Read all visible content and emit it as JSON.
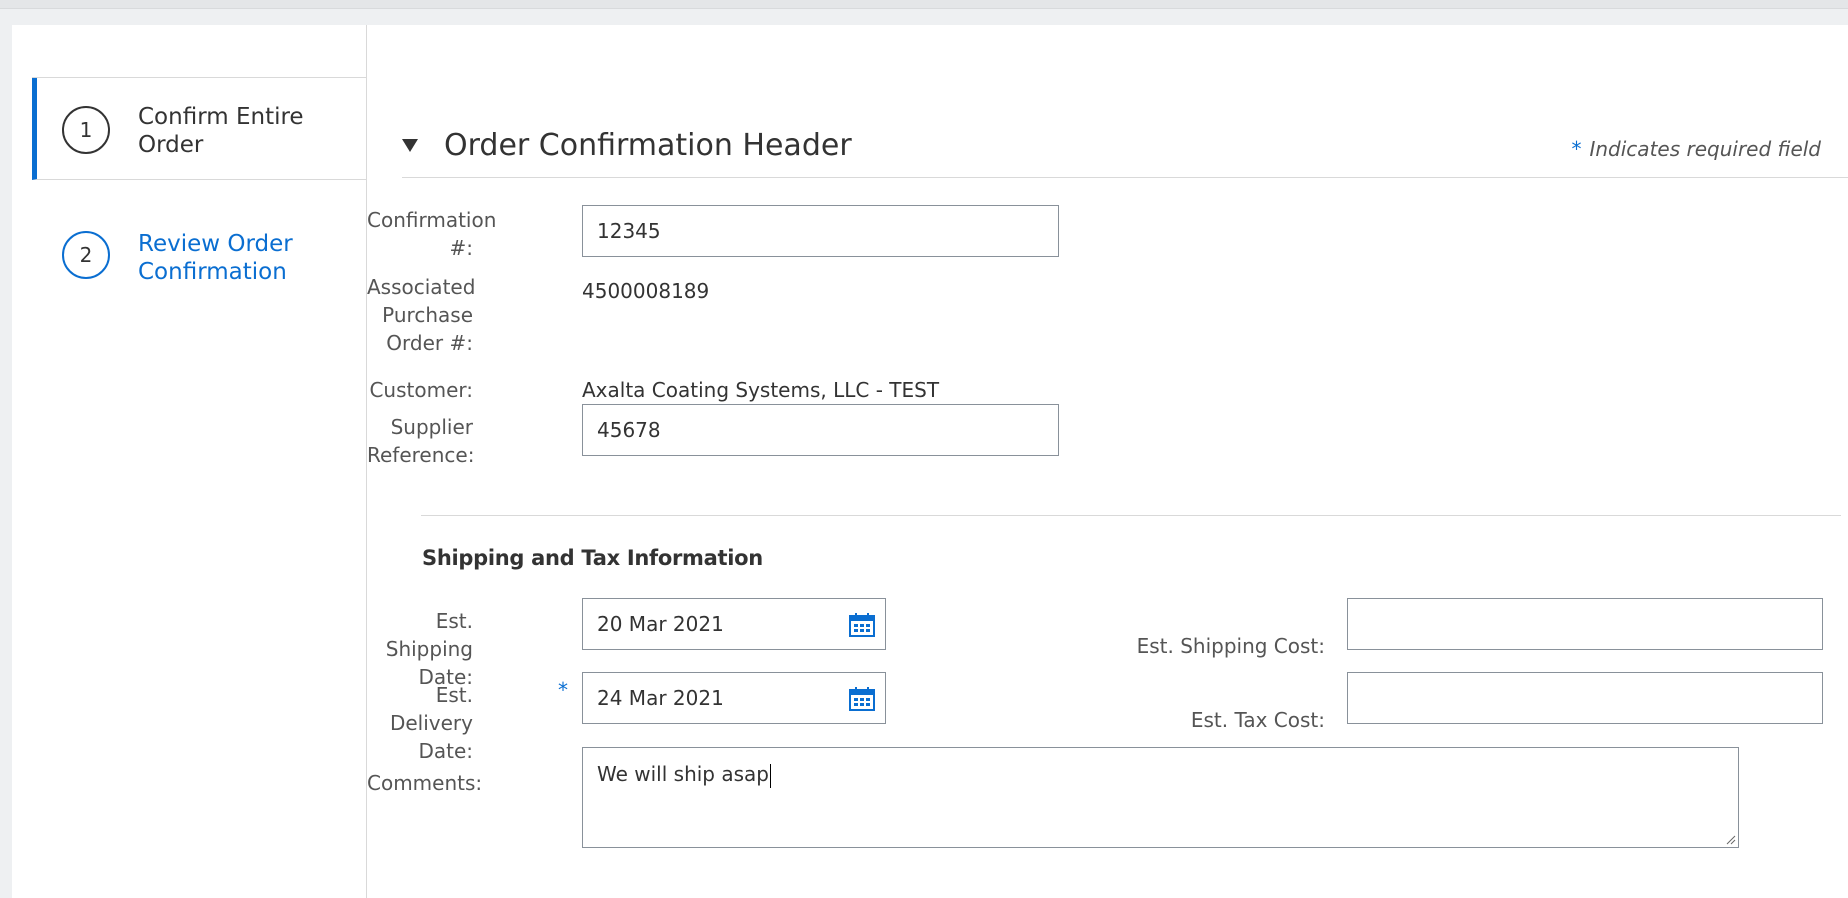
{
  "wizard": {
    "steps": [
      {
        "number": "1",
        "label": "Confirm Entire Order"
      },
      {
        "number": "2",
        "label": "Review Order Confirmation"
      }
    ]
  },
  "header": {
    "title": "Order Confirmation Header",
    "required_star": "*",
    "required_note": "Indicates required field"
  },
  "fields": {
    "confirmation_label": "Confirmation #:",
    "confirmation_value": "12345",
    "po_label": "Associated Purchase Order #:",
    "po_value": "4500008189",
    "customer_label": "Customer:",
    "customer_value": "Axalta Coating Systems, LLC - TEST",
    "supplier_ref_label": "Supplier Reference:",
    "supplier_ref_value": "45678"
  },
  "shipping": {
    "title": "Shipping and Tax Information",
    "ship_date_label": "Est. Shipping Date:",
    "ship_date_value": "20 Mar 2021",
    "delivery_date_label": "Est. Delivery Date:",
    "delivery_required": "*",
    "delivery_date_value": "24 Mar 2021",
    "ship_cost_label": "Est. Shipping Cost:",
    "ship_cost_value": "",
    "tax_cost_label": "Est. Tax Cost:",
    "tax_cost_value": "",
    "comments_label": "Comments:",
    "comments_value": "We will ship asap"
  },
  "colors": {
    "accent": "#0a6ed1",
    "border": "#89919a"
  }
}
